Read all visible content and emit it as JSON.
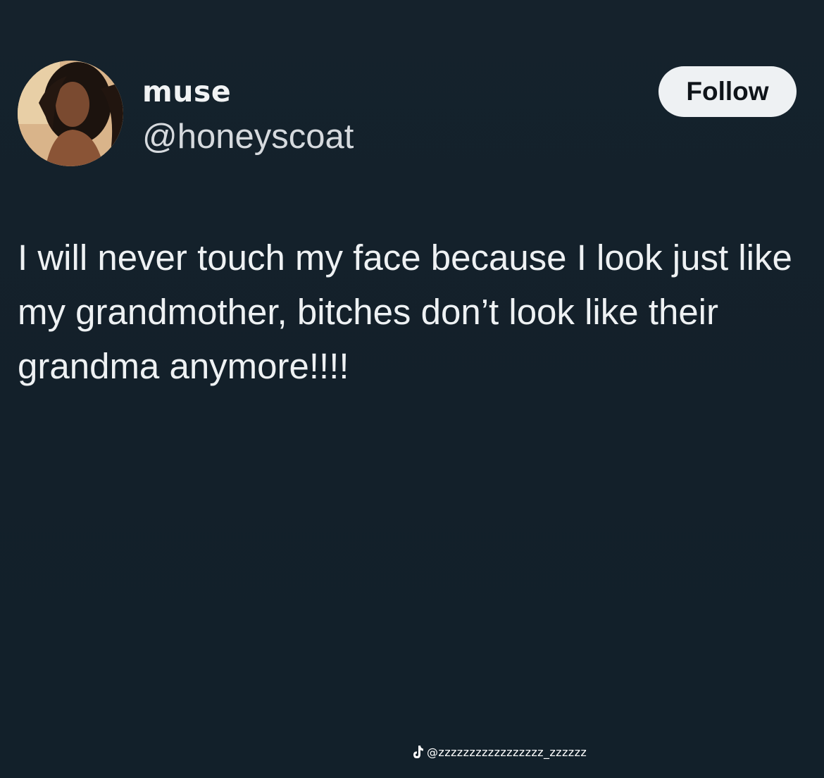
{
  "profile": {
    "display_name": "muse",
    "handle": "@honeyscoat",
    "avatar_icon": "profile-photo"
  },
  "follow_button": {
    "label": "Follow"
  },
  "tweet": {
    "text": "I will never touch my face because I look just like my grandmother, bitches don’t look like their grandma anymore!!!!"
  },
  "watermark": {
    "icon": "tiktok-icon",
    "username": "@zzzzzzzzzzzzzzzzz_zzzzzz"
  },
  "colors": {
    "background": "#14202a",
    "text": "#eef1f3",
    "button_bg": "#eef1f3",
    "button_text": "#0f1419"
  }
}
